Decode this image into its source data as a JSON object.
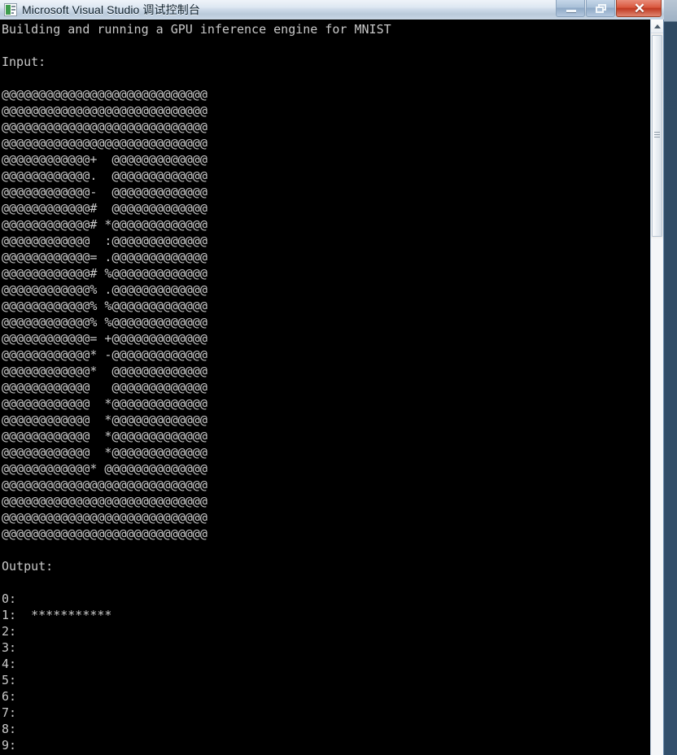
{
  "window": {
    "title": "Microsoft Visual Studio 调试控制台",
    "icon": "console-app-icon",
    "buttons": {
      "minimize": "minimize-icon",
      "restore": "restore-icon",
      "close": "✕"
    }
  },
  "console": {
    "colors": {
      "background": "#000000",
      "foreground": "#c8c8c8"
    },
    "header_line": "Building and running a GPU inference engine for MNIST",
    "input_label": "Input:",
    "output_label": "Output:",
    "ascii_art_rows": [
      "@@@@@@@@@@@@@@@@@@@@@@@@@@@@",
      "@@@@@@@@@@@@@@@@@@@@@@@@@@@@",
      "@@@@@@@@@@@@@@@@@@@@@@@@@@@@",
      "@@@@@@@@@@@@@@@@@@@@@@@@@@@@",
      "@@@@@@@@@@@@+  @@@@@@@@@@@@@",
      "@@@@@@@@@@@@.  @@@@@@@@@@@@@",
      "@@@@@@@@@@@@-  @@@@@@@@@@@@@",
      "@@@@@@@@@@@@#  @@@@@@@@@@@@@",
      "@@@@@@@@@@@@# *@@@@@@@@@@@@@",
      "@@@@@@@@@@@@  :@@@@@@@@@@@@@",
      "@@@@@@@@@@@@= .@@@@@@@@@@@@@",
      "@@@@@@@@@@@@# %@@@@@@@@@@@@@",
      "@@@@@@@@@@@@% .@@@@@@@@@@@@@",
      "@@@@@@@@@@@@% %@@@@@@@@@@@@@",
      "@@@@@@@@@@@@% %@@@@@@@@@@@@@",
      "@@@@@@@@@@@@= +@@@@@@@@@@@@@",
      "@@@@@@@@@@@@* -@@@@@@@@@@@@@",
      "@@@@@@@@@@@@*  @@@@@@@@@@@@@",
      "@@@@@@@@@@@@   @@@@@@@@@@@@@",
      "@@@@@@@@@@@@  *@@@@@@@@@@@@@",
      "@@@@@@@@@@@@  *@@@@@@@@@@@@@",
      "@@@@@@@@@@@@  *@@@@@@@@@@@@@",
      "@@@@@@@@@@@@  *@@@@@@@@@@@@@",
      "@@@@@@@@@@@@* @@@@@@@@@@@@@@",
      "@@@@@@@@@@@@@@@@@@@@@@@@@@@@",
      "@@@@@@@@@@@@@@@@@@@@@@@@@@@@",
      "@@@@@@@@@@@@@@@@@@@@@@@@@@@@",
      "@@@@@@@@@@@@@@@@@@@@@@@@@@@@"
    ],
    "output_rows": [
      {
        "label": "0:",
        "bar": ""
      },
      {
        "label": "1:",
        "bar": "***********"
      },
      {
        "label": "2:",
        "bar": ""
      },
      {
        "label": "3:",
        "bar": ""
      },
      {
        "label": "4:",
        "bar": ""
      },
      {
        "label": "5:",
        "bar": ""
      },
      {
        "label": "6:",
        "bar": ""
      },
      {
        "label": "7:",
        "bar": ""
      },
      {
        "label": "8:",
        "bar": ""
      },
      {
        "label": "9:",
        "bar": ""
      }
    ],
    "full_text": "Building and running a GPU inference engine for MNIST\n\nInput:\n\n@@@@@@@@@@@@@@@@@@@@@@@@@@@@\n@@@@@@@@@@@@@@@@@@@@@@@@@@@@\n@@@@@@@@@@@@@@@@@@@@@@@@@@@@\n@@@@@@@@@@@@@@@@@@@@@@@@@@@@\n@@@@@@@@@@@@+  @@@@@@@@@@@@@\n@@@@@@@@@@@@.  @@@@@@@@@@@@@\n@@@@@@@@@@@@-  @@@@@@@@@@@@@\n@@@@@@@@@@@@#  @@@@@@@@@@@@@\n@@@@@@@@@@@@# *@@@@@@@@@@@@@\n@@@@@@@@@@@@  :@@@@@@@@@@@@@\n@@@@@@@@@@@@= .@@@@@@@@@@@@@\n@@@@@@@@@@@@# %@@@@@@@@@@@@@\n@@@@@@@@@@@@% .@@@@@@@@@@@@@\n@@@@@@@@@@@@% %@@@@@@@@@@@@@\n@@@@@@@@@@@@% %@@@@@@@@@@@@@\n@@@@@@@@@@@@= +@@@@@@@@@@@@@\n@@@@@@@@@@@@* -@@@@@@@@@@@@@\n@@@@@@@@@@@@*  @@@@@@@@@@@@@\n@@@@@@@@@@@@   @@@@@@@@@@@@@\n@@@@@@@@@@@@  *@@@@@@@@@@@@@\n@@@@@@@@@@@@  *@@@@@@@@@@@@@\n@@@@@@@@@@@@  *@@@@@@@@@@@@@\n@@@@@@@@@@@@  *@@@@@@@@@@@@@\n@@@@@@@@@@@@* @@@@@@@@@@@@@@\n@@@@@@@@@@@@@@@@@@@@@@@@@@@@\n@@@@@@@@@@@@@@@@@@@@@@@@@@@@\n@@@@@@@@@@@@@@@@@@@@@@@@@@@@\n@@@@@@@@@@@@@@@@@@@@@@@@@@@@\n\nOutput:\n\n0:\n1:  ***********\n2:\n3:\n4:\n5:\n6:\n7:\n8:\n9:"
  },
  "scrollbar": {
    "up_arrow": "scroll-up-icon",
    "thumb": "scroll-thumb"
  }
}
